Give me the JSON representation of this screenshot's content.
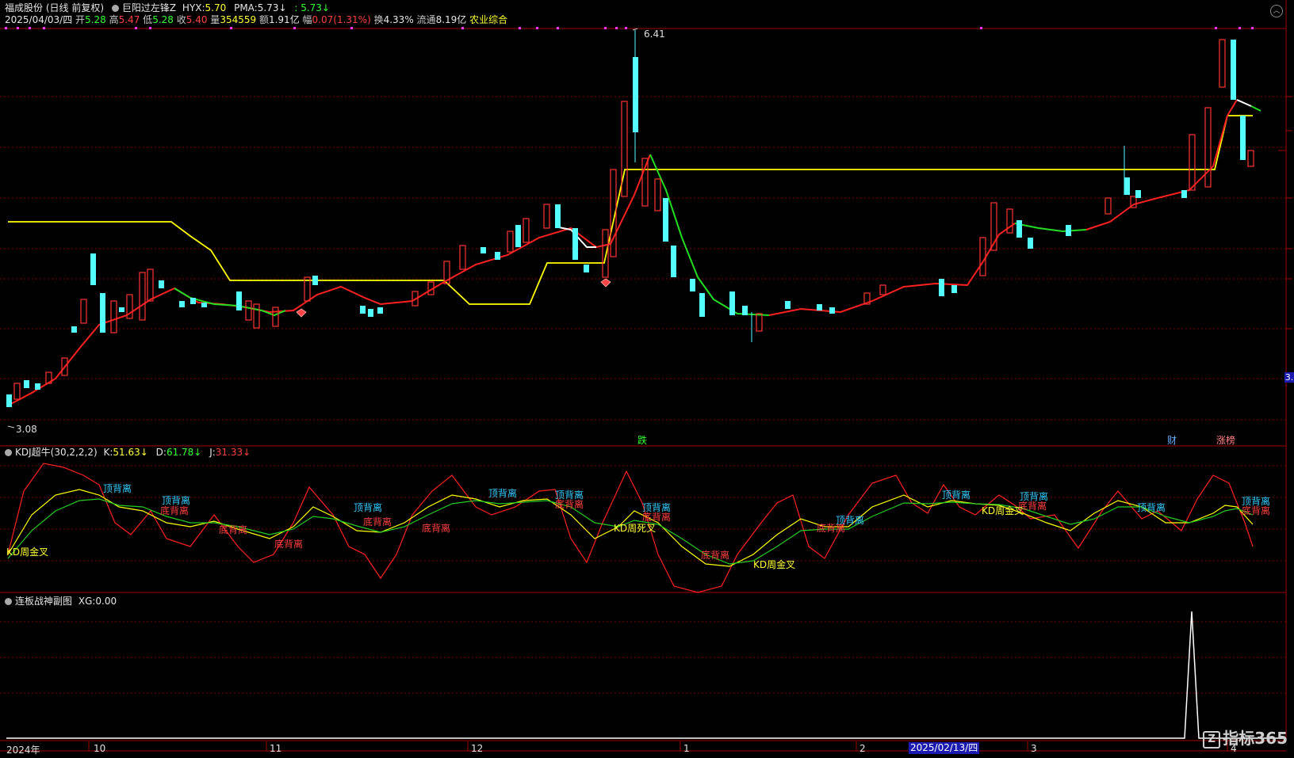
{
  "header": {
    "stock_name": "福成股份",
    "period": "(日线 前复权)",
    "indicator_name": "巨阳过左锋Z",
    "hyx_label": "HYX:",
    "hyx_value": "5.70",
    "pma_label": "PMA:",
    "pma_value": "5.73↓",
    "extra_value": ": 5.73↓"
  },
  "quote": {
    "date": "2025/04/03/四",
    "open_label": "开",
    "open": "5.28",
    "high_label": "高",
    "high": "5.47",
    "low_label": "低",
    "low": "5.28",
    "close_label": "收",
    "close": "5.40",
    "vol_label": "量",
    "vol": "354559",
    "amount_label": "额",
    "amount": "1.91亿",
    "chg_label": "幅",
    "chg": "0.07(1.31%)",
    "turnover_label": "换",
    "turnover": "4.33%",
    "float_label": "流通",
    "float": "8.19亿",
    "sector": "农业综合"
  },
  "price_labels": {
    "high": "6.41",
    "low": "3.08"
  },
  "main_tags": {
    "die": "跌",
    "cai": "财",
    "zhangbang": "涨榜",
    "right_scale": "3."
  },
  "kdj": {
    "title": "KDJ超牛(30,2,2,2)",
    "k_label": "K:",
    "k": "51.63↓",
    "d_label": "D:",
    "d": "61.78↓",
    "j_label": "J:",
    "j": "31.33↓",
    "signals": {
      "s1": "KD周金叉",
      "s2": "顶背离",
      "s3": "顶背离",
      "s4": "底背离",
      "s5": "底背离",
      "s6": "底背离",
      "s7": "顶背离",
      "s8": "底背离",
      "s9": "底背离",
      "s10": "顶背离",
      "s11": "顶背离",
      "s12": "底背离",
      "s13": "KD周死叉",
      "s14": "顶背离",
      "s15": "底背离",
      "s16": "底背离",
      "s17": "KD周金叉",
      "s18": "底背离",
      "s19": "顶背离",
      "s20": "顶背离",
      "s21": "KD周金叉",
      "s22": "顶背离",
      "s23": "底背离",
      "s24": "顶背离",
      "s25": "顶背离",
      "s26": "底背离"
    }
  },
  "sub": {
    "title": "连板战神副图",
    "xg_label": "XG:",
    "xg": "0.00"
  },
  "dates": {
    "d1": "2024年",
    "d2": "10",
    "d3": "11",
    "d4": "12",
    "d5": "1",
    "d6": "2",
    "selected": "2025/02/13/四",
    "d7": "3",
    "d8": "4"
  },
  "logo": {
    "mark": "Z",
    "text": "指标365"
  },
  "colors": {
    "up": "#ff3333",
    "down": "#54ffff",
    "ma_red": "#ff2020",
    "ma_green": "#22dd22",
    "yellow": "#ffff00",
    "grid": "#7a0000"
  },
  "chart_data": [
    {
      "type": "candlestick",
      "title": "",
      "ylim": [
        3.08,
        6.41
      ],
      "annotations": [
        "6.41",
        "3.08"
      ],
      "series": [
        {
          "values": [
            3.2,
            3.3,
            3.45,
            3.6,
            3.75,
            4.1,
            4.55,
            4.6,
            4.5,
            4.45,
            4.55,
            4.7,
            4.8,
            4.6,
            4.5,
            4.45,
            4.4,
            4.35,
            4.3,
            4.45,
            4.55,
            4.6,
            4.5,
            4.45,
            4.4,
            4.35,
            4.3,
            4.4,
            4.55,
            4.7,
            4.85,
            5.0,
            5.1,
            5.2,
            5.3,
            5.1,
            4.9,
            5.0,
            5.6,
            6.1,
            5.9,
            5.4,
            4.9,
            4.5,
            4.4,
            4.3,
            4.35,
            4.4,
            4.45,
            4.4,
            4.5,
            4.55,
            4.6,
            4.65,
            4.7,
            4.75,
            4.7,
            5.0,
            5.3,
            5.4,
            5.35,
            5.3,
            5.4,
            5.5,
            5.6,
            5.65,
            5.7,
            5.8,
            6.0,
            6.2,
            5.9,
            5.4
          ]
        }
      ]
    },
    {
      "type": "line",
      "title": "",
      "series": [
        {
          "values": [
            10,
            40,
            75,
            70,
            55,
            35,
            60,
            85,
            70,
            45,
            35,
            60,
            75,
            55,
            40,
            30,
            65,
            80,
            60,
            70,
            75,
            55,
            30,
            20,
            25,
            40,
            70,
            60,
            80,
            75,
            60,
            45,
            70,
            75,
            60,
            50,
            65,
            45
          ]
        },
        {
          "values": [
            10,
            30,
            55,
            60,
            55,
            45,
            50,
            65,
            62,
            52,
            45,
            52,
            62,
            58,
            50,
            42,
            52,
            65,
            62,
            64,
            68,
            60,
            45,
            32,
            30,
            36,
            55,
            58,
            66,
            68,
            64,
            56,
            62,
            68,
            64,
            58,
            62,
            52
          ]
        },
        {
          "values": [
            10,
            50,
            95,
            88,
            55,
            20,
            75,
            100,
            80,
            35,
            20,
            75,
            95,
            50,
            25,
            10,
            80,
            100,
            55,
            80,
            90,
            45,
            10,
            0,
            10,
            45,
            95,
            65,
            100,
            90,
            50,
            30,
            85,
            90,
            50,
            35,
            80,
            30
          ]
        }
      ]
    },
    {
      "type": "line",
      "title": "",
      "series": [
        {
          "values": [
            0,
            0,
            0,
            0,
            0,
            0,
            0,
            0,
            0,
            0,
            0,
            0,
            0,
            0,
            0,
            0,
            0,
            0,
            0,
            0,
            0,
            0,
            0,
            0,
            0,
            0,
            0,
            0,
            0,
            0,
            0,
            0,
            0,
            0,
            0,
            0,
            0,
            0,
            0,
            0,
            0,
            0,
            0,
            0,
            0,
            0,
            0,
            0,
            0,
            0,
            0,
            0,
            0,
            0,
            0,
            0,
            0,
            0,
            0,
            0,
            0,
            0,
            0,
            0,
            0,
            0,
            0,
            0,
            0,
            0,
            1,
            0
          ]
        }
      ]
    }
  ]
}
